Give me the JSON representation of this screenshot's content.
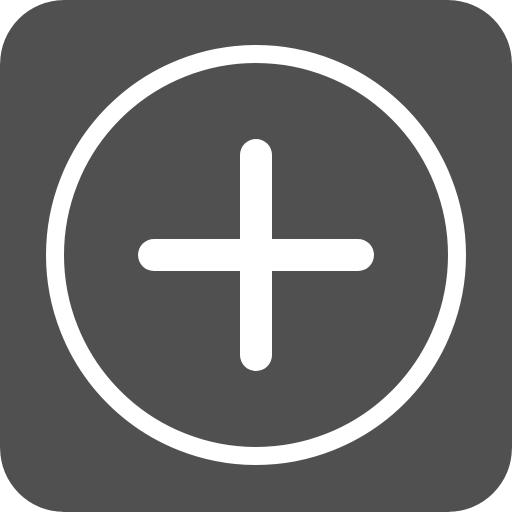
{
  "icon": {
    "name": "add-icon",
    "background_color": "#505050",
    "foreground_color": "#ffffff"
  }
}
